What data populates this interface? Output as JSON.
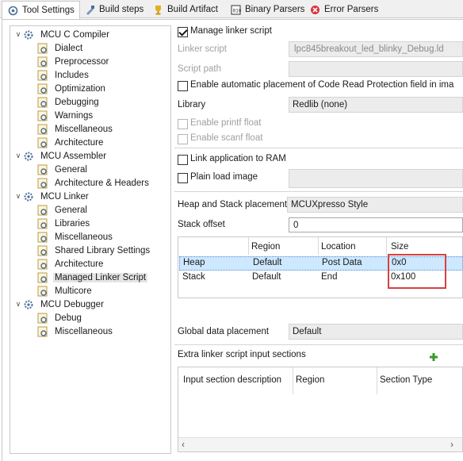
{
  "tabs": [
    {
      "label": "Tool Settings",
      "icon": "tool-settings-icon"
    },
    {
      "label": "Build steps",
      "icon": "build-steps-icon"
    },
    {
      "label": "Build Artifact",
      "icon": "trophy-icon"
    },
    {
      "label": "Binary Parsers",
      "icon": "binary-icon"
    },
    {
      "label": "Error Parsers",
      "icon": "error-icon"
    }
  ],
  "tree": {
    "compiler": {
      "label": "MCU C Compiler",
      "children": [
        "Dialect",
        "Preprocessor",
        "Includes",
        "Optimization",
        "Debugging",
        "Warnings",
        "Miscellaneous",
        "Architecture"
      ]
    },
    "assembler": {
      "label": "MCU Assembler",
      "children": [
        "General",
        "Architecture & Headers"
      ]
    },
    "linker": {
      "label": "MCU Linker",
      "children": [
        "General",
        "Libraries",
        "Miscellaneous",
        "Shared Library Settings",
        "Architecture",
        "Managed Linker Script",
        "Multicore"
      ]
    },
    "debugger": {
      "label": "MCU Debugger",
      "children": [
        "Debug",
        "Miscellaneous"
      ]
    }
  },
  "settings": {
    "manage_linker_script": "Manage linker script",
    "linker_script_label": "Linker script",
    "linker_script_value": "lpc845breakout_led_blinky_Debug.ld",
    "script_path_label": "Script path",
    "script_path_value": "",
    "crp_label": "Enable automatic placement of Code Read Protection field in ima",
    "library_label": "Library",
    "library_value": "Redlib (none)",
    "printf_float": "Enable printf float",
    "scanf_float": "Enable scanf float",
    "link_to_ram": "Link application to RAM",
    "plain_load": "Plain load image",
    "heap_stack_label": "Heap and Stack placement",
    "heap_stack_value": "MCUXpresso Style",
    "stack_offset_label": "Stack offset",
    "stack_offset_value": "0",
    "global_data_label": "Global data placement",
    "global_data_value": "Default",
    "extra_sections_label": "Extra linker script input sections"
  },
  "heap_table": {
    "headers": [
      "",
      "Region",
      "Location",
      "Size"
    ],
    "rows": [
      [
        "Heap",
        "Default",
        "Post Data",
        "0x0"
      ],
      [
        "Stack",
        "Default",
        "End",
        "0x100"
      ]
    ]
  },
  "extra_table": {
    "headers": [
      "Input section description",
      "Region",
      "Section Type"
    ]
  },
  "colors": {
    "highlight": "#d94040",
    "add": "#3a9a2a",
    "selection": "#e5e5e5",
    "row_select": "#cde8ff"
  }
}
